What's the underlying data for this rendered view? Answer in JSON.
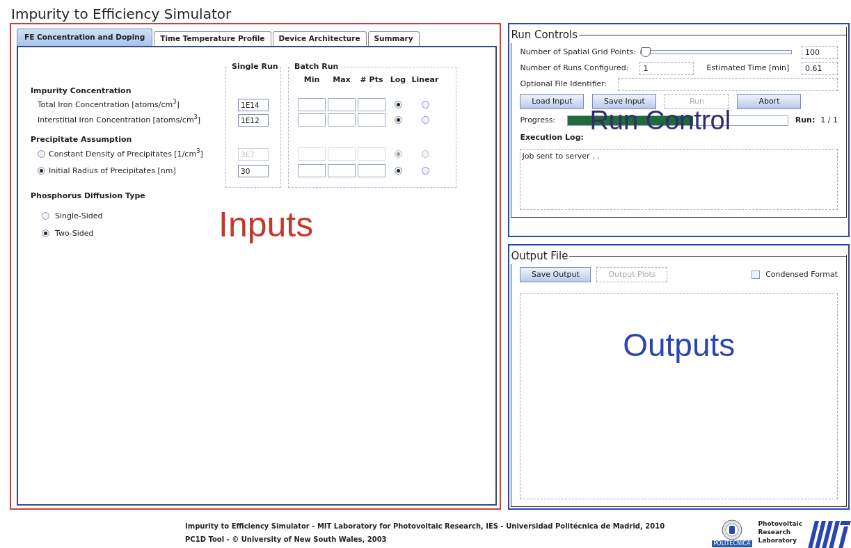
{
  "window": {
    "title": "Impurity to Efficiency Simulator"
  },
  "tabs": [
    {
      "label": "FE Concentration and Doping",
      "selected": true
    },
    {
      "label": "Time Temperature Profile",
      "selected": false
    },
    {
      "label": "Device Architecture",
      "selected": false
    },
    {
      "label": "Summary",
      "selected": false
    }
  ],
  "inputs": {
    "annotation": "Inputs",
    "single_run_title": "Single Run",
    "batch_run_title": "Batch Run",
    "batch_columns": [
      "Min",
      "Max",
      "# Pts",
      "Log",
      "Linear"
    ],
    "sections": [
      {
        "heading": "Impurity Concentration",
        "rows": [
          {
            "kind": "plain",
            "label": "Total Iron Concentration [atoms/cm$^{3}$]",
            "value": "1E14",
            "disabled": false,
            "log": true
          },
          {
            "kind": "plain",
            "label": "Interstitial Iron Concentration [atoms/cm$^{3}$]",
            "value": "1E12",
            "disabled": false,
            "log": true
          }
        ]
      },
      {
        "heading": "Precipitate Assumption",
        "rows": [
          {
            "kind": "radio",
            "label": "Constant Density of Precipitates [1/cm$^{3}$]",
            "selected": false,
            "value": "3E7",
            "disabled": true,
            "log": true
          },
          {
            "kind": "radio",
            "label": "Initial Radius of Precipitates [nm]",
            "selected": true,
            "value": "30",
            "disabled": false,
            "log": true
          }
        ]
      }
    ],
    "diffusion": {
      "heading": "Phosphorus Diffusion Type",
      "options": [
        {
          "label": "Single-Sided",
          "selected": false
        },
        {
          "label": "Two-Sided",
          "selected": true
        }
      ]
    }
  },
  "run_controls": {
    "title": "Run Controls",
    "annotation": "Run Control",
    "grid_points_label": "Number of Spatial Grid Points:",
    "grid_points_slider": {
      "level": 0.0
    },
    "grid_points_value": "100",
    "runs_label": "Number of Runs Configured:",
    "runs_value": "1",
    "time_label": "Estimated Time [min]",
    "time_value": "0.61",
    "file_id_label": "Optional File Identifier:",
    "buttons": [
      {
        "label": "Load Input",
        "disabled": false
      },
      {
        "label": "Save Input",
        "disabled": false
      },
      {
        "label": "Run",
        "disabled": true
      },
      {
        "label": "Abort",
        "disabled": false
      }
    ],
    "progress_label": "Progress:",
    "progress": {
      "level": 0.57
    },
    "run_label": "Run:",
    "run_value": "1 / 1",
    "log_label": "Execution Log:",
    "log_text": "Job sent to server . ."
  },
  "output_file": {
    "title": "Output File",
    "annotation": "Outputs",
    "buttons": [
      {
        "label": "Save Output",
        "disabled": false
      },
      {
        "label": "Output Plots",
        "disabled": true
      }
    ],
    "condensed": {
      "label": "Condensed Format",
      "checked": false
    }
  },
  "footer": {
    "lines": [
      "Impurity to Efficiency Simulator - MIT Laboratory for Photovoltaic Research, IES - Universidad Politécnica de Madrid, 2010",
      "PC1D Tool - © University of New South Wales, 2003"
    ],
    "university_label": "POLITECNICA",
    "lab_lines": [
      "Photovoltaic",
      "Research",
      "Laboratory"
    ]
  }
}
